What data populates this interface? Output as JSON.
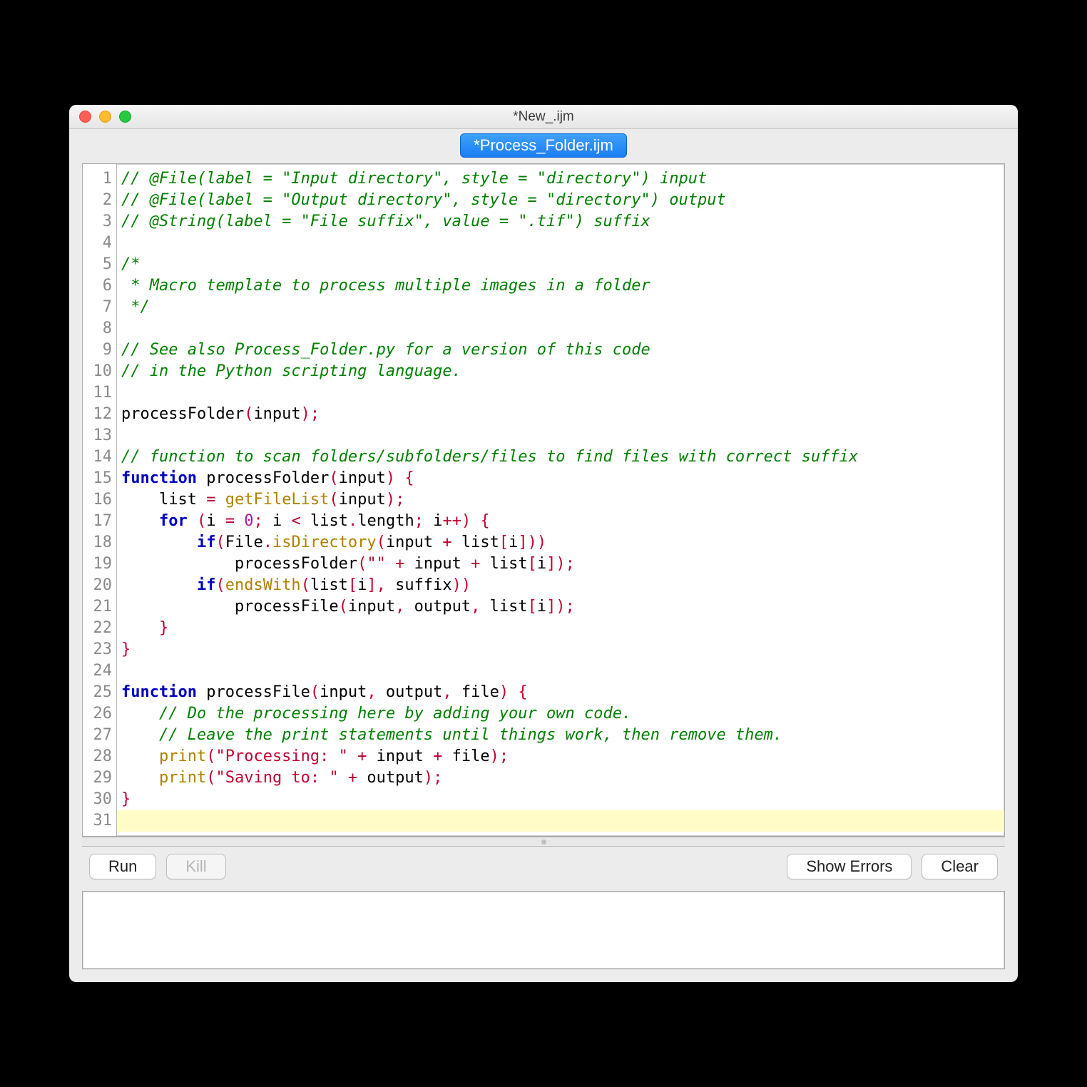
{
  "window": {
    "title": "*New_.ijm"
  },
  "tab": {
    "label": "*Process_Folder.ijm"
  },
  "buttons": {
    "run": "Run",
    "kill": "Kill",
    "show_errors": "Show Errors",
    "clear": "Clear"
  },
  "code_lines": [
    [
      [
        "c",
        "// @File(label = \"Input directory\", style = \"directory\") input"
      ]
    ],
    [
      [
        "c",
        "// @File(label = \"Output directory\", style = \"directory\") output"
      ]
    ],
    [
      [
        "c",
        "// @String(label = \"File suffix\", value = \".tif\") suffix"
      ]
    ],
    [],
    [
      [
        "c",
        "/*"
      ]
    ],
    [
      [
        "c",
        " * Macro template to process multiple images in a folder"
      ]
    ],
    [
      [
        "c",
        " */"
      ]
    ],
    [],
    [
      [
        "c",
        "// See also Process_Folder.py for a version of this code"
      ]
    ],
    [
      [
        "c",
        "// in the Python scripting language."
      ]
    ],
    [],
    [
      [
        "id",
        "processFolder"
      ],
      [
        "p",
        "("
      ],
      [
        "id",
        "input"
      ],
      [
        "p",
        ");"
      ]
    ],
    [],
    [
      [
        "c",
        "// function to scan folders/subfolders/files to find files with correct suffix"
      ]
    ],
    [
      [
        "k",
        "function"
      ],
      [
        "id",
        " processFolder"
      ],
      [
        "p",
        "("
      ],
      [
        "id",
        "input"
      ],
      [
        "p",
        ") {"
      ]
    ],
    [
      [
        "id",
        "    list "
      ],
      [
        "p",
        "="
      ],
      [
        "id",
        " "
      ],
      [
        "f",
        "getFileList"
      ],
      [
        "p",
        "("
      ],
      [
        "id",
        "input"
      ],
      [
        "p",
        ");"
      ]
    ],
    [
      [
        "id",
        "    "
      ],
      [
        "k",
        "for"
      ],
      [
        "id",
        " "
      ],
      [
        "p",
        "("
      ],
      [
        "id",
        "i "
      ],
      [
        "p",
        "="
      ],
      [
        "id",
        " "
      ],
      [
        "n",
        "0"
      ],
      [
        "p",
        ";"
      ],
      [
        "id",
        " i "
      ],
      [
        "p",
        "<"
      ],
      [
        "id",
        " list"
      ],
      [
        "p",
        "."
      ],
      [
        "id",
        "length"
      ],
      [
        "p",
        ";"
      ],
      [
        "id",
        " i"
      ],
      [
        "p",
        "++) {"
      ]
    ],
    [
      [
        "id",
        "        "
      ],
      [
        "k",
        "if"
      ],
      [
        "p",
        "("
      ],
      [
        "id",
        "File"
      ],
      [
        "p",
        "."
      ],
      [
        "f",
        "isDirectory"
      ],
      [
        "p",
        "("
      ],
      [
        "id",
        "input "
      ],
      [
        "p",
        "+"
      ],
      [
        "id",
        " list"
      ],
      [
        "p",
        "["
      ],
      [
        "id",
        "i"
      ],
      [
        "p",
        "]))"
      ]
    ],
    [
      [
        "id",
        "            processFolder"
      ],
      [
        "p",
        "("
      ],
      [
        "s",
        "\"\""
      ],
      [
        "id",
        " "
      ],
      [
        "p",
        "+"
      ],
      [
        "id",
        " input "
      ],
      [
        "p",
        "+"
      ],
      [
        "id",
        " list"
      ],
      [
        "p",
        "["
      ],
      [
        "id",
        "i"
      ],
      [
        "p",
        "]);"
      ]
    ],
    [
      [
        "id",
        "        "
      ],
      [
        "k",
        "if"
      ],
      [
        "p",
        "("
      ],
      [
        "f",
        "endsWith"
      ],
      [
        "p",
        "("
      ],
      [
        "id",
        "list"
      ],
      [
        "p",
        "["
      ],
      [
        "id",
        "i"
      ],
      [
        "p",
        "],"
      ],
      [
        "id",
        " suffix"
      ],
      [
        "p",
        "))"
      ]
    ],
    [
      [
        "id",
        "            processFile"
      ],
      [
        "p",
        "("
      ],
      [
        "id",
        "input"
      ],
      [
        "p",
        ","
      ],
      [
        "id",
        " output"
      ],
      [
        "p",
        ","
      ],
      [
        "id",
        " list"
      ],
      [
        "p",
        "["
      ],
      [
        "id",
        "i"
      ],
      [
        "p",
        "]);"
      ]
    ],
    [
      [
        "id",
        "    "
      ],
      [
        "p",
        "}"
      ]
    ],
    [
      [
        "p",
        "}"
      ]
    ],
    [],
    [
      [
        "k",
        "function"
      ],
      [
        "id",
        " processFile"
      ],
      [
        "p",
        "("
      ],
      [
        "id",
        "input"
      ],
      [
        "p",
        ","
      ],
      [
        "id",
        " output"
      ],
      [
        "p",
        ","
      ],
      [
        "id",
        " file"
      ],
      [
        "p",
        ") {"
      ]
    ],
    [
      [
        "id",
        "    "
      ],
      [
        "c",
        "// Do the processing here by adding your own code."
      ]
    ],
    [
      [
        "id",
        "    "
      ],
      [
        "c",
        "// Leave the print statements until things work, then remove them."
      ]
    ],
    [
      [
        "id",
        "    "
      ],
      [
        "f",
        "print"
      ],
      [
        "p",
        "("
      ],
      [
        "s",
        "\"Processing: \""
      ],
      [
        "id",
        " "
      ],
      [
        "p",
        "+"
      ],
      [
        "id",
        " input "
      ],
      [
        "p",
        "+"
      ],
      [
        "id",
        " file"
      ],
      [
        "p",
        ");"
      ]
    ],
    [
      [
        "id",
        "    "
      ],
      [
        "f",
        "print"
      ],
      [
        "p",
        "("
      ],
      [
        "s",
        "\"Saving to: \""
      ],
      [
        "id",
        " "
      ],
      [
        "p",
        "+"
      ],
      [
        "id",
        " output"
      ],
      [
        "p",
        ");"
      ]
    ],
    [
      [
        "p",
        "}"
      ]
    ],
    []
  ],
  "cursor_line": 31,
  "total_lines": 31
}
